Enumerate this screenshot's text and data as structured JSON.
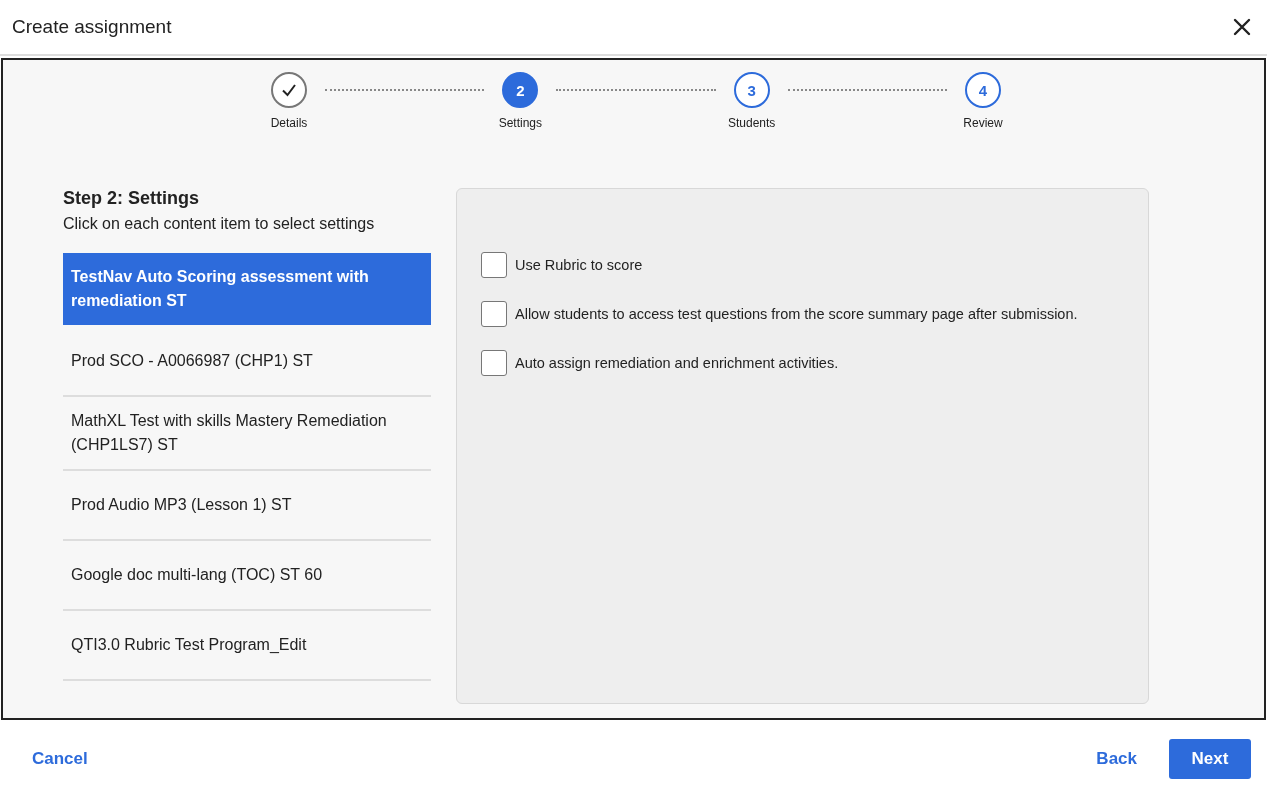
{
  "dialog": {
    "title": "Create assignment"
  },
  "steps": [
    {
      "label": "Details",
      "completed": true,
      "selected": false
    },
    {
      "label": "Settings",
      "number": "2",
      "completed": false,
      "selected": true
    },
    {
      "label": "Students",
      "number": "3",
      "completed": false,
      "selected": false
    },
    {
      "label": "Review",
      "number": "4",
      "completed": false,
      "selected": false
    }
  ],
  "heading": "Step 2: Settings",
  "instruction": "Click on each content item to select settings",
  "items": [
    {
      "label": "TestNav Auto Scoring assessment with remediation ST",
      "selected": true
    },
    {
      "label": "Prod SCO - A0066987 (CHP1) ST",
      "selected": false
    },
    {
      "label": "MathXL Test with skills Mastery Remediation (CHP1LS7) ST",
      "selected": false
    },
    {
      "label": "Prod Audio MP3 (Lesson 1) ST",
      "selected": false
    },
    {
      "label": "Google doc multi-lang (TOC) ST 60",
      "selected": false
    },
    {
      "label": "QTI3.0 Rubric Test Program_Edit",
      "selected": false
    }
  ],
  "options": [
    {
      "label": "Use Rubric to score",
      "checked": false
    },
    {
      "label": "Allow students to access test questions from the score summary page after submission.",
      "checked": false
    },
    {
      "label": "Auto assign remediation and enrichment activities.",
      "checked": false
    }
  ],
  "footer": {
    "cancel": "Cancel",
    "back": "Back",
    "next": "Next"
  }
}
